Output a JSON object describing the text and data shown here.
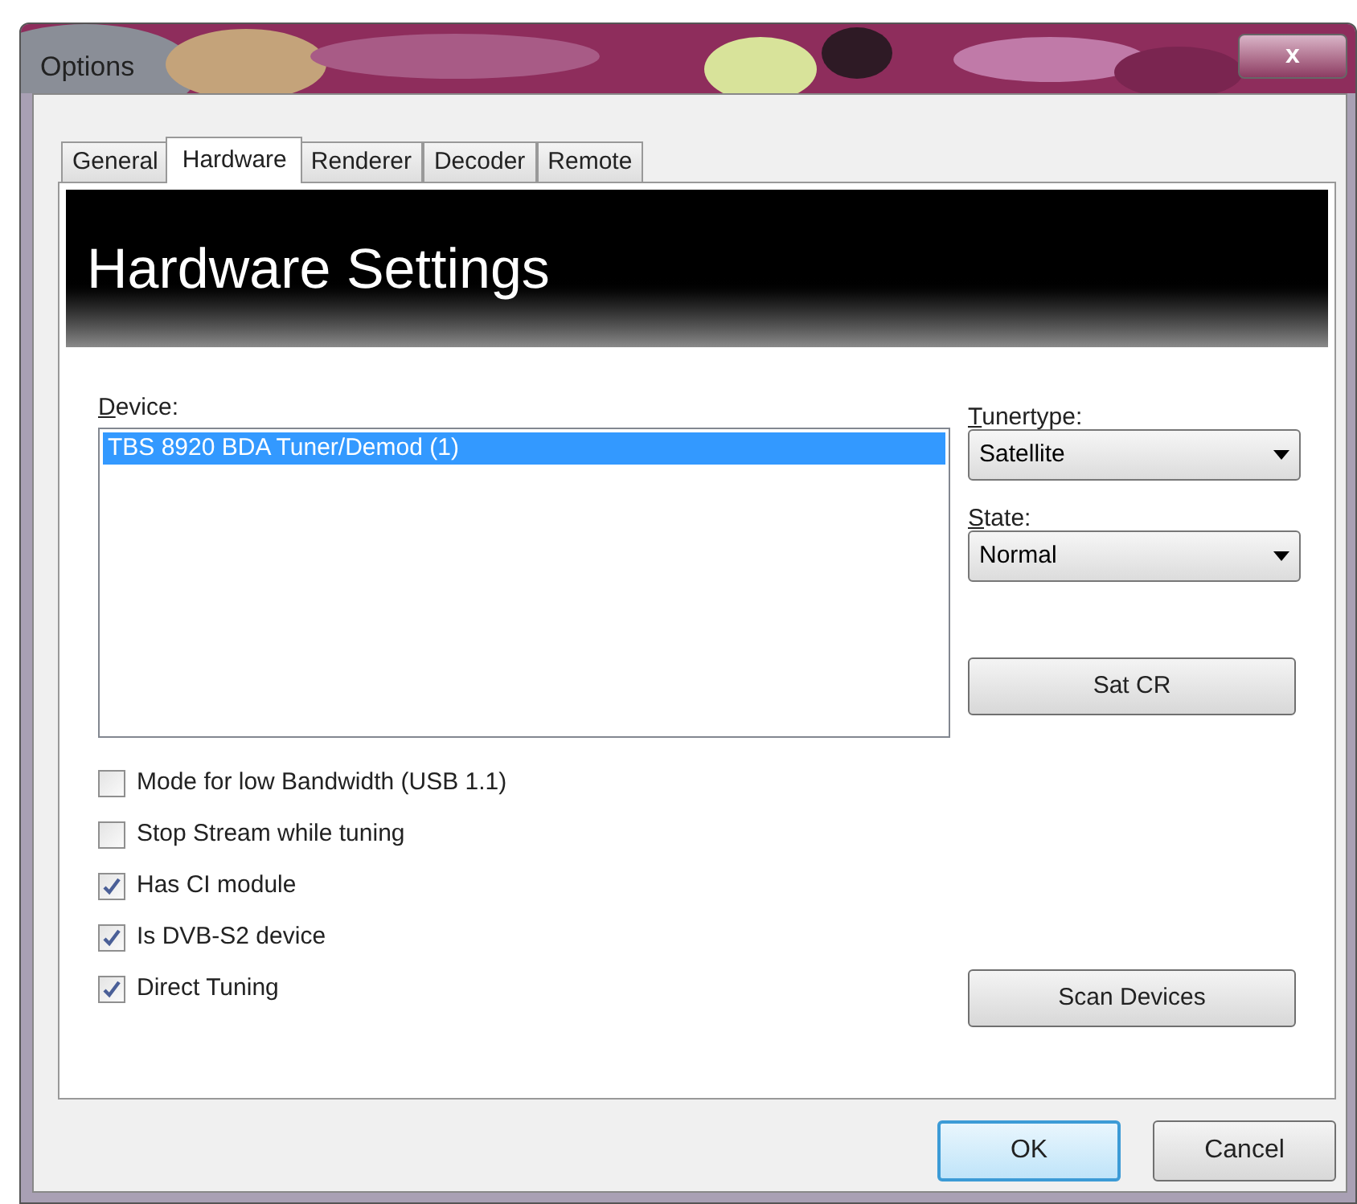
{
  "window": {
    "title": "Options",
    "close": "x"
  },
  "tabs": [
    {
      "label": "General",
      "selected": false
    },
    {
      "label": "Hardware",
      "selected": true
    },
    {
      "label": "Renderer",
      "selected": false
    },
    {
      "label": "Decoder",
      "selected": false
    },
    {
      "label": "Remote",
      "selected": false
    }
  ],
  "header": "Hardware Settings",
  "device": {
    "label": "Device:",
    "items": [
      {
        "label": "TBS 8920 BDA Tuner/Demod (1)",
        "selected": true
      }
    ]
  },
  "options": [
    {
      "label": "Mode for low Bandwidth (USB 1.1)",
      "checked": false
    },
    {
      "label": "Stop Stream while tuning",
      "checked": false
    },
    {
      "label": "Has CI module",
      "checked": true
    },
    {
      "label": "Is DVB-S2 device",
      "checked": true
    },
    {
      "label": "Direct Tuning",
      "checked": true
    }
  ],
  "tunertype": {
    "label": "Tunertype:",
    "value": "Satellite"
  },
  "state": {
    "label": "State:",
    "value": "Normal"
  },
  "sat_cr_button": "Sat CR",
  "scan_button": "Scan Devices",
  "buttons": [
    {
      "label": "OK",
      "default": true
    },
    {
      "label": "Cancel",
      "default": false
    }
  ]
}
